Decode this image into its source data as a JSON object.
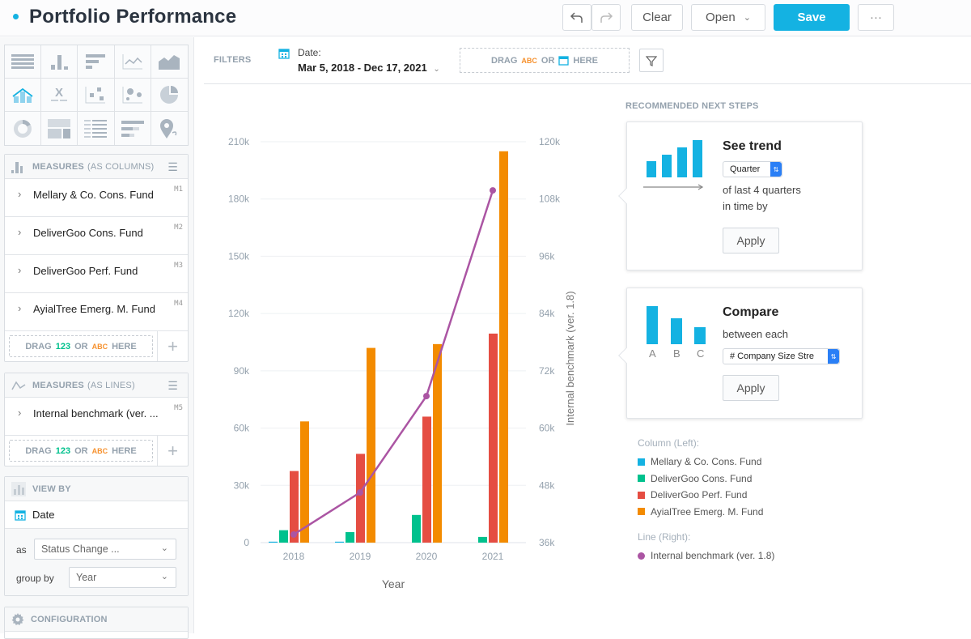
{
  "header": {
    "title": "Portfolio Performance",
    "undo_icon": "undo-icon",
    "redo_icon": "redo-icon",
    "clear_label": "Clear",
    "open_label": "Open",
    "save_label": "Save",
    "more_label": "···"
  },
  "sidebar": {
    "viz_types": [
      "table",
      "column",
      "bar",
      "line",
      "area",
      "combo",
      "headline",
      "scatter",
      "bubble",
      "pie",
      "donut",
      "treemap",
      "heatmap",
      "bullet",
      "geo"
    ],
    "measures_columns": {
      "title": "MEASURES",
      "subtitle": "(AS COLUMNS)",
      "items": [
        {
          "label": "Mellary & Co. Cons. Fund",
          "tag": "M1"
        },
        {
          "label": "DeliverGoo Cons. Fund",
          "tag": "M2"
        },
        {
          "label": "DeliverGoo Perf. Fund",
          "tag": "M3"
        },
        {
          "label": "AyialTree Emerg. M. Fund",
          "tag": "M4"
        }
      ]
    },
    "measures_lines": {
      "title": "MEASURES",
      "subtitle": "(AS LINES)",
      "items": [
        {
          "label": "Internal benchmark (ver. ...",
          "tag": "M5"
        }
      ]
    },
    "dropzone": {
      "drag": "DRAG",
      "num": "123",
      "or": "OR",
      "abc": "ABC",
      "here": "HERE"
    },
    "view_by": {
      "title": "VIEW BY",
      "attribute": "Date",
      "as_label": "as",
      "as_value": "Status Change ...",
      "group_by_label": "group by",
      "group_by_value": "Year"
    },
    "configuration": {
      "title": "CONFIGURATION"
    }
  },
  "filters": {
    "label": "FILTERS",
    "date_label": "Date:",
    "date_value": "Mar 5, 2018 - Dec 17, 2021",
    "drop": {
      "drag": "DRAG",
      "abc": "ABC",
      "or": "OR",
      "here": "HERE"
    }
  },
  "chart_data": {
    "type": "bar",
    "categories": [
      "2018",
      "2019",
      "2020",
      "2021"
    ],
    "xlabel": "Year",
    "ylabel": "",
    "y2label": "Internal benchmark (ver. 1.8)",
    "ylim": [
      0,
      210000
    ],
    "y_ticks": [
      "0",
      "30k",
      "60k",
      "90k",
      "120k",
      "150k",
      "180k",
      "210k"
    ],
    "y2lim": [
      36000,
      120000
    ],
    "y2_ticks": [
      "36k",
      "48k",
      "60k",
      "72k",
      "84k",
      "96k",
      "108k",
      "120k"
    ],
    "grid": true,
    "series": [
      {
        "name": "Mellary & Co. Cons. Fund",
        "type": "bar",
        "axis": "left",
        "color": "#14b2e2",
        "values": [
          500,
          500,
          0,
          0
        ]
      },
      {
        "name": "DeliverGoo Cons. Fund",
        "type": "bar",
        "axis": "left",
        "color": "#00c18d",
        "values": [
          6500,
          5500,
          14500,
          3000
        ]
      },
      {
        "name": "DeliverGoo Perf. Fund",
        "type": "bar",
        "axis": "left",
        "color": "#e54d42",
        "values": [
          37500,
          46500,
          66000,
          109500
        ]
      },
      {
        "name": "AyialTree Emerg. M. Fund",
        "type": "bar",
        "axis": "left",
        "color": "#f38b00",
        "values": [
          63500,
          102000,
          104000,
          205000
        ]
      },
      {
        "name": "Internal benchmark (ver. 1.8)",
        "type": "line",
        "axis": "right",
        "color": "#ab55a3",
        "values": [
          37700,
          46500,
          66700,
          109800
        ]
      }
    ]
  },
  "recommendations": {
    "title": "RECOMMENDED NEXT STEPS",
    "trend": {
      "heading": "See trend",
      "select_value": "Quarter",
      "text_line1": "of last 4 quarters",
      "text_line2": "in time by",
      "apply_label": "Apply"
    },
    "compare": {
      "heading": "Compare",
      "text": "between each",
      "select_value": "# Company Size Stre",
      "bar_labels": [
        "A",
        "B",
        "C"
      ],
      "apply_label": "Apply"
    }
  },
  "legend": {
    "column_title": "Column (Left):",
    "line_title": "Line (Right):",
    "columns": [
      {
        "label": "Mellary & Co. Cons. Fund",
        "color": "#14b2e2"
      },
      {
        "label": "DeliverGoo Cons. Fund",
        "color": "#00c18d"
      },
      {
        "label": "DeliverGoo Perf. Fund",
        "color": "#e54d42"
      },
      {
        "label": "AyialTree Emerg. M. Fund",
        "color": "#f38b00"
      }
    ],
    "lines": [
      {
        "label": "Internal benchmark (ver. 1.8)",
        "color": "#ab55a3"
      }
    ]
  }
}
